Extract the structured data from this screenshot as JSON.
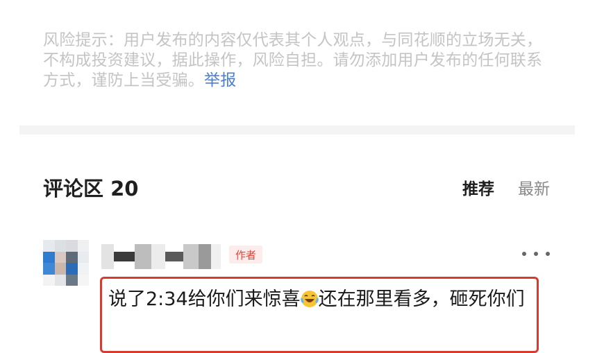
{
  "risk_notice": {
    "text": "风险提示：用户发布的内容仅代表其个人观点，与同花顺的立场无关，不构成投资建议，据此操作，风险自担。请勿添加用户发布的任何联系方式，谨防上当受骗。",
    "report_link": "举报"
  },
  "comments": {
    "title": "评论区 20",
    "sort_tabs": [
      {
        "label": "推荐",
        "active": true
      },
      {
        "label": "最新",
        "active": false
      }
    ]
  },
  "comment": {
    "badge": "作者",
    "text_before_emoji": "说了2:34给你们来惊喜",
    "emoji": "laughing-tears-emoji",
    "text_after_emoji": "还在那里看多，砸死你们"
  },
  "colors": {
    "accent_link": "#4a7fd4",
    "badge_red": "#e0473a",
    "highlight_border": "#d93a2e"
  }
}
